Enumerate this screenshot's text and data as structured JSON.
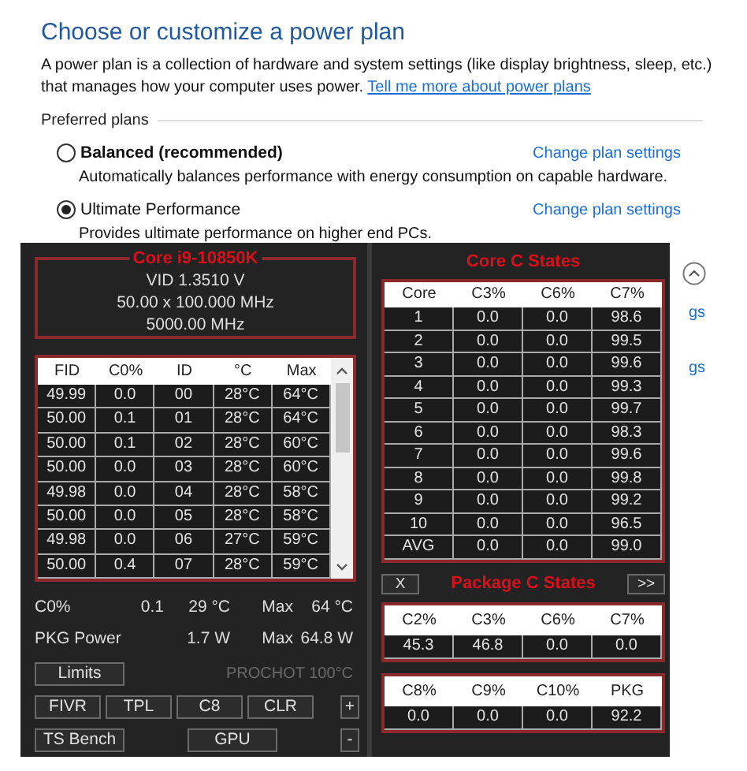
{
  "page": {
    "title": "Choose or customize a power plan",
    "description": "A power plan is a collection of hardware and system settings (like display brightness, sleep, etc.) that manages how your computer uses power.",
    "link": "Tell me more about power plans"
  },
  "plans_heading": "Preferred plans",
  "plans": [
    {
      "name": "Balanced (recommended)",
      "recommended": true,
      "selected": false,
      "description": "Automatically balances performance with energy consumption on capable hardware.",
      "link": "Change plan settings"
    },
    {
      "name": "Ultimate Performance",
      "recommended": false,
      "selected": true,
      "description": "Provides ultimate performance on higher end PCs.",
      "link": "Change plan settings"
    }
  ],
  "cut_links": [
    "gs",
    "gs"
  ],
  "throttlestop": {
    "cpu": {
      "name": "Core i9-10850K",
      "lines": [
        "VID  1.3510 V",
        "50.00 x 100.000 MHz",
        "5000.00 MHz"
      ]
    },
    "core_table": {
      "columns": [
        "FID",
        "C0%",
        "ID",
        "°C",
        "Max"
      ],
      "rows": [
        [
          "49.99",
          "0.0",
          "00",
          "28°C",
          "64°C"
        ],
        [
          "50.00",
          "0.1",
          "01",
          "28°C",
          "64°C"
        ],
        [
          "50.00",
          "0.1",
          "02",
          "28°C",
          "60°C"
        ],
        [
          "50.00",
          "0.0",
          "03",
          "28°C",
          "60°C"
        ],
        [
          "49.98",
          "0.0",
          "04",
          "28°C",
          "58°C"
        ],
        [
          "50.00",
          "0.0",
          "05",
          "28°C",
          "58°C"
        ],
        [
          "49.98",
          "0.0",
          "06",
          "27°C",
          "59°C"
        ],
        [
          "50.00",
          "0.4",
          "07",
          "28°C",
          "59°C"
        ]
      ]
    },
    "stats": [
      {
        "label": "C0%",
        "value": "0.1",
        "reading": "29 °C",
        "max_label": "Max",
        "max": "64 °C"
      },
      {
        "label": "PKG Power",
        "reading": "1.7 W",
        "max_label": "Max",
        "max": "64.8 W"
      }
    ],
    "limits_button": "Limits",
    "prochot": {
      "text": "PROCHOT 100°C",
      "disabled": true
    },
    "button_row": [
      "FIVR",
      "TPL",
      "C8",
      "CLR",
      "+"
    ],
    "bottom_buttons": [
      "TS Bench",
      "GPU",
      "-"
    ],
    "core_c_states": {
      "title": "Core C States",
      "columns": [
        "Core",
        "C3%",
        "C6%",
        "C7%"
      ],
      "rows": [
        [
          "1",
          "0.0",
          "0.0",
          "98.6"
        ],
        [
          "2",
          "0.0",
          "0.0",
          "99.5"
        ],
        [
          "3",
          "0.0",
          "0.0",
          "99.6"
        ],
        [
          "4",
          "0.0",
          "0.0",
          "99.3"
        ],
        [
          "5",
          "0.0",
          "0.0",
          "99.7"
        ],
        [
          "6",
          "0.0",
          "0.0",
          "98.3"
        ],
        [
          "7",
          "0.0",
          "0.0",
          "99.6"
        ],
        [
          "8",
          "0.0",
          "0.0",
          "99.8"
        ],
        [
          "9",
          "0.0",
          "0.0",
          "99.2"
        ],
        [
          "10",
          "0.0",
          "0.0",
          "96.5"
        ],
        [
          "AVG",
          "0.0",
          "0.0",
          "99.0"
        ]
      ]
    },
    "package": {
      "close_button": "X",
      "title": "Package C States",
      "next_button": ">>",
      "tables": [
        {
          "columns": [
            "C2%",
            "C3%",
            "C6%",
            "C7%"
          ],
          "values": [
            "45.3",
            "46.8",
            "0.0",
            "0.0"
          ]
        },
        {
          "columns": [
            "C8%",
            "C9%",
            "C10%",
            "PKG"
          ],
          "values": [
            "0.0",
            "0.0",
            "0.0",
            "92.2"
          ]
        }
      ]
    }
  }
}
